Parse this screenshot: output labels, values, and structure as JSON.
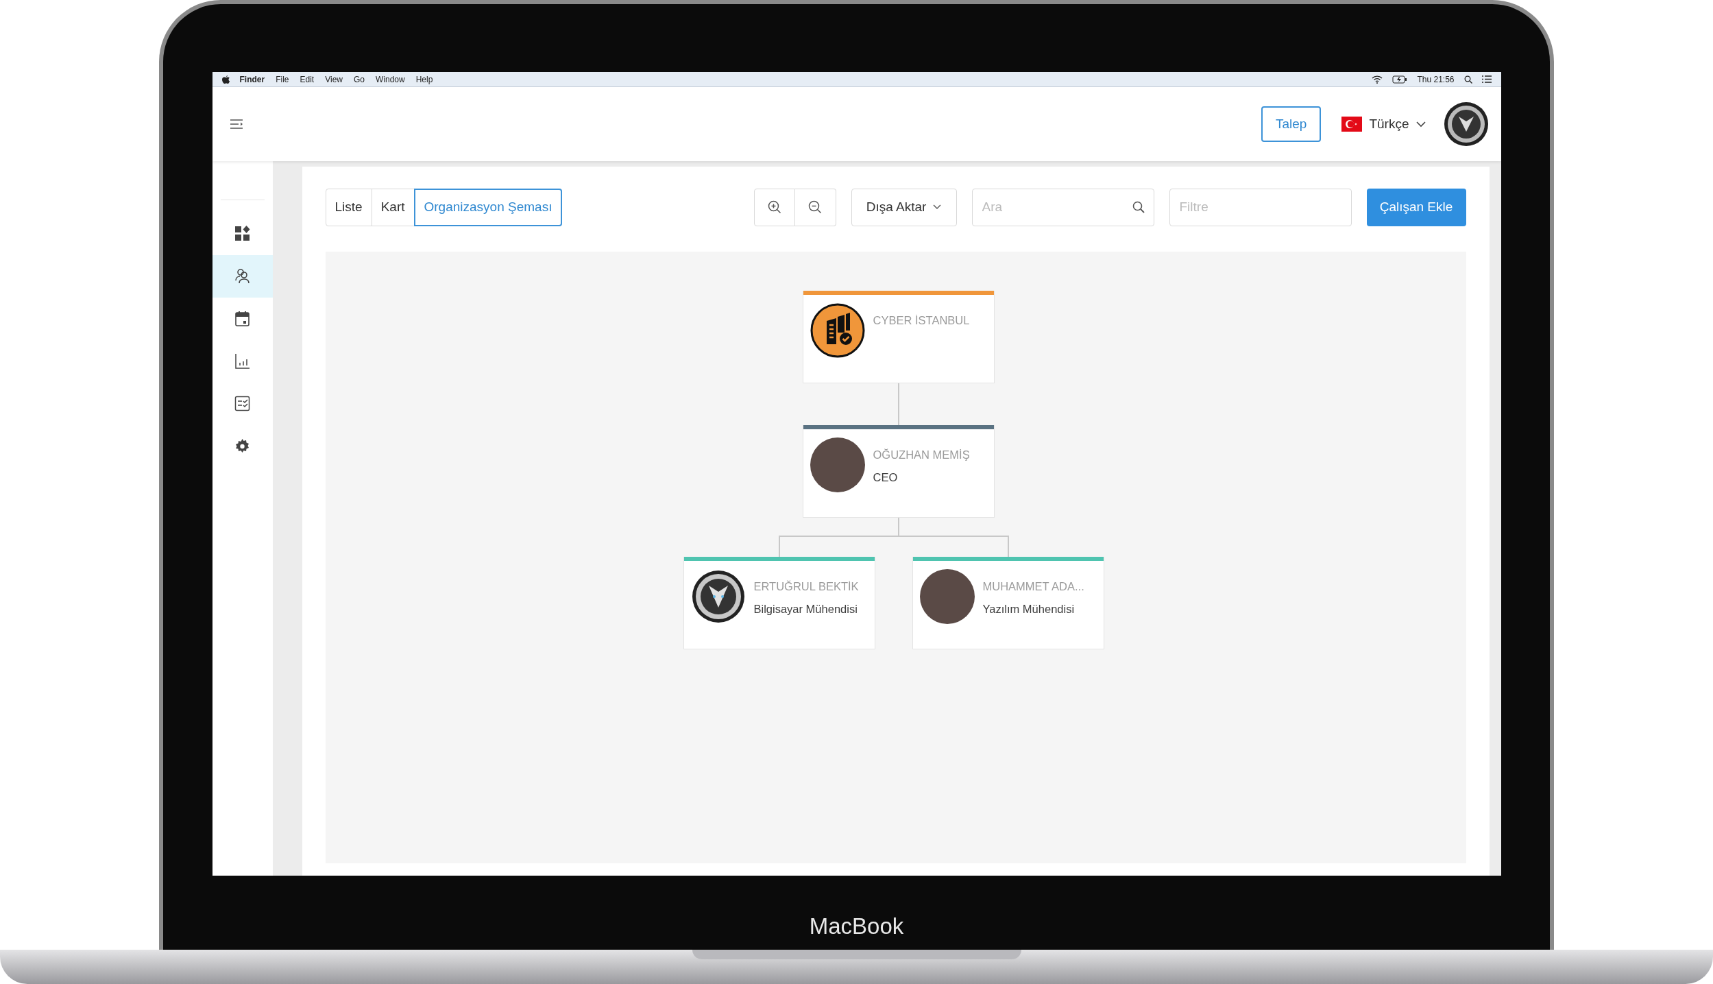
{
  "device": {
    "label": "MacBook"
  },
  "menu_bar": {
    "items": [
      {
        "label": "Finder",
        "kind": "app"
      },
      {
        "label": "File",
        "kind": "menu"
      },
      {
        "label": "Edit",
        "kind": "menu"
      },
      {
        "label": "View",
        "kind": "menu"
      },
      {
        "label": "Go",
        "kind": "menu"
      },
      {
        "label": "Window",
        "kind": "menu"
      },
      {
        "label": "Help",
        "kind": "menu"
      }
    ],
    "clock": "Thu 21:56"
  },
  "header": {
    "request_button": "Talep",
    "language": "Türkçe"
  },
  "sidebar": {
    "items": [
      {
        "kind": "dashboard",
        "selected": false
      },
      {
        "kind": "people",
        "selected": true
      },
      {
        "kind": "calendar",
        "selected": false
      },
      {
        "kind": "chart",
        "selected": false
      },
      {
        "kind": "checklist",
        "selected": false
      },
      {
        "kind": "settings",
        "selected": false
      }
    ]
  },
  "toolbar": {
    "tabs": [
      {
        "label": "Liste",
        "selected": false
      },
      {
        "label": "Kart",
        "selected": false
      },
      {
        "label": "Organizasyon Şeması",
        "selected": true
      }
    ],
    "export": "Dışa Aktar",
    "search": {
      "placeholder": "Ara"
    },
    "filter": {
      "placeholder": "Filtre"
    },
    "add_button": "Çalışan Ekle"
  },
  "org_chart": {
    "root": {
      "kind": "company",
      "name": "CYBER İSTANBUL",
      "color": "#f0963a",
      "children": [
        {
          "kind": "photo",
          "name": "OĞUZHAN MEMİŞ",
          "title": "CEO",
          "color": "#5a7282",
          "children": [
            {
              "kind": "emblem",
              "name": "ERTUĞRUL BEKTİK",
              "title": "Bilgisayar Mühendisi",
              "color": "#4fc4b0"
            },
            {
              "kind": "photo",
              "name": "MUHAMMET ADA...",
              "title": "Yazılım Mühendisi",
              "color": "#4fc4b0"
            }
          ]
        }
      ]
    }
  }
}
